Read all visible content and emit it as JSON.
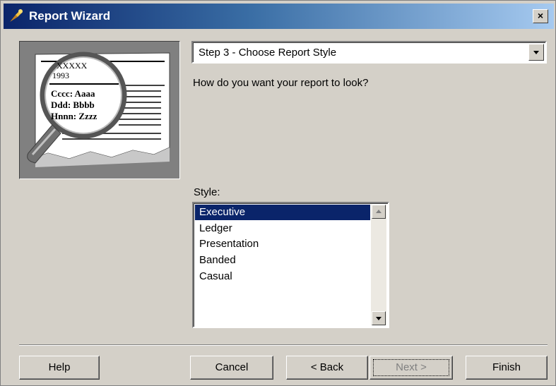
{
  "window": {
    "title": "Report Wizard",
    "close_label": "×"
  },
  "step_combo": {
    "value": "Step 3 - Choose Report Style"
  },
  "question": "How do you want your report to look?",
  "style": {
    "label": "Style:",
    "options": [
      "Executive",
      "Ledger",
      "Presentation",
      "Banded",
      "Casual"
    ],
    "selected": "Executive"
  },
  "illustration": {
    "lines": [
      "XXXXX",
      "1993",
      "Cccc: Aaaa",
      "Ddd: Bbbb",
      "Hnnn: Zzzz"
    ]
  },
  "buttons": {
    "help": "Help",
    "cancel": "Cancel",
    "back": "< Back",
    "next": "Next >",
    "finish": "Finish"
  },
  "colors": {
    "title_start": "#0a246a",
    "title_end": "#a6caf0",
    "selection": "#0a246a",
    "face": "#d4d0c8"
  }
}
